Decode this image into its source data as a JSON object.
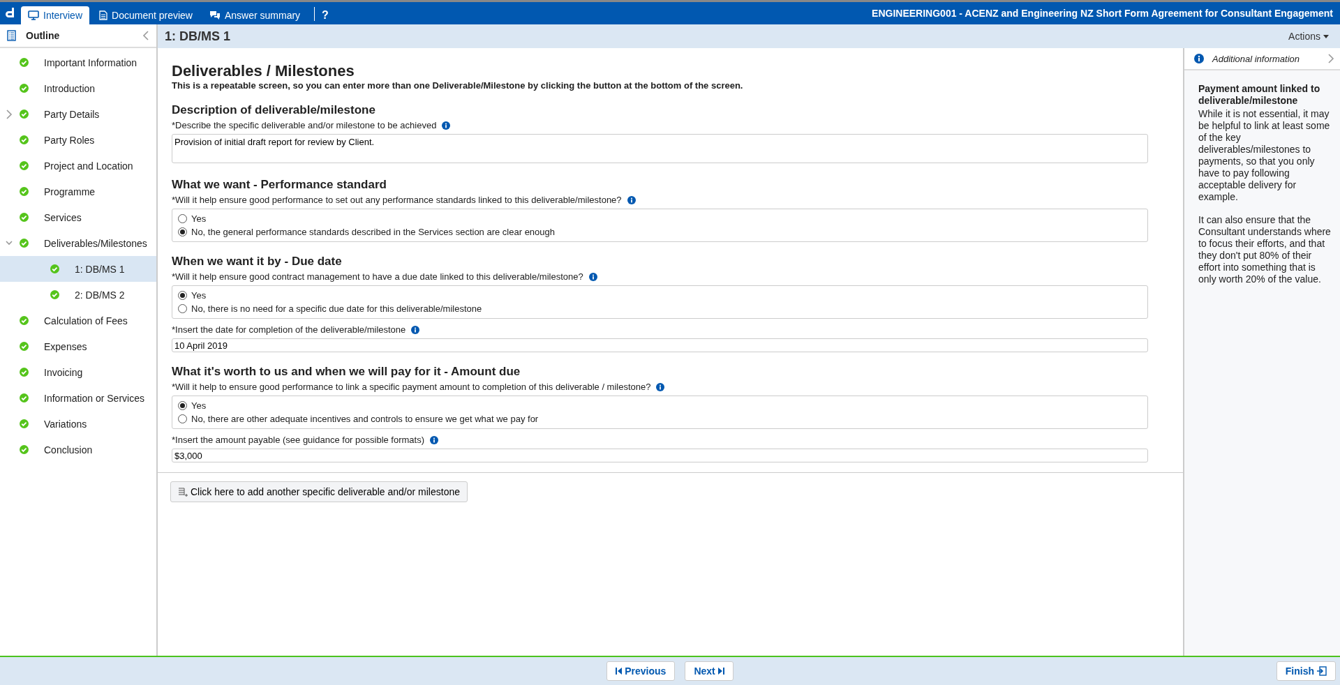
{
  "top_bar": {
    "tabs": [
      {
        "label": "Interview",
        "selected": true
      },
      {
        "label": "Document preview",
        "selected": false
      },
      {
        "label": "Answer summary",
        "selected": false
      }
    ],
    "help": "?",
    "title": "ENGINEERING001 - ACENZ and Engineering NZ Short Form Agreement for Consultant Engagement"
  },
  "sidebar": {
    "title": "Outline",
    "items": [
      {
        "label": "Important Information",
        "selected": false
      },
      {
        "label": "Introduction",
        "selected": false
      },
      {
        "label": "Party Details",
        "selected": false,
        "expanded": false
      },
      {
        "label": "Party Roles",
        "selected": false
      },
      {
        "label": "Project and Location",
        "selected": false
      },
      {
        "label": "Programme",
        "selected": false
      },
      {
        "label": "Services",
        "selected": false
      },
      {
        "label": "Deliverables/Milestones",
        "selected": false,
        "expanded": true,
        "children": [
          {
            "label": "1: DB/MS 1",
            "selected": true
          },
          {
            "label": "2: DB/MS 2",
            "selected": false
          }
        ]
      },
      {
        "label": "Calculation of Fees",
        "selected": false
      },
      {
        "label": "Expenses",
        "selected": false
      },
      {
        "label": "Invoicing",
        "selected": false
      },
      {
        "label": "Information or Services",
        "selected": false
      },
      {
        "label": "Variations",
        "selected": false
      },
      {
        "label": "Conclusion",
        "selected": false
      }
    ]
  },
  "page_header": {
    "title": "1: DB/MS 1",
    "actions": "Actions"
  },
  "form": {
    "title": "Deliverables / Milestones",
    "intro": "This is a repeatable screen, so you can enter more than one Deliverable/Milestone by clicking the button at the bottom of the screen.",
    "sections": [
      {
        "heading": "Description of deliverable/milestone",
        "questions": [
          {
            "kind": "textarea",
            "label": "*Describe the specific deliverable and/or milestone to be achieved",
            "value": "Provision of initial draft report for review by Client."
          }
        ]
      },
      {
        "heading": "What we want - Performance standard",
        "questions": [
          {
            "kind": "radio",
            "label": "*Will it help ensure good performance to set out any performance standards linked to this deliverable/milestone?",
            "options": [
              {
                "label": "Yes",
                "selected": false
              },
              {
                "label": "No, the general performance standards described in the Services section are clear enough",
                "selected": true
              }
            ]
          }
        ]
      },
      {
        "heading": "When we want it by - Due date",
        "questions": [
          {
            "kind": "radio",
            "label": "*Will it help ensure good contract management to have a due date linked to this deliverable/milestone?",
            "options": [
              {
                "label": "Yes",
                "selected": true
              },
              {
                "label": "No, there is no need for a specific due date for this deliverable/milestone",
                "selected": false
              }
            ]
          },
          {
            "kind": "text",
            "label": "*Insert the date for completion of the deliverable/milestone",
            "value": "10 April 2019"
          }
        ]
      },
      {
        "heading": "What it's worth to us and when we will pay for it - Amount due",
        "questions": [
          {
            "kind": "radio",
            "label": "*Will it help to ensure good performance to link a specific payment amount to completion of this deliverable / milestone?",
            "options": [
              {
                "label": "Yes",
                "selected": true
              },
              {
                "label": "No, there are other adequate incentives and controls to ensure we get what we pay for",
                "selected": false
              }
            ]
          },
          {
            "kind": "text",
            "label": "*Insert the amount payable (see guidance for possible formats)",
            "value": "$3,000"
          }
        ]
      }
    ],
    "add_button": "Click here to add another specific deliverable and/or milestone"
  },
  "info_panel": {
    "title": "Additional information",
    "heading": "Payment amount linked to deliverable/milestone",
    "paragraphs": [
      "While it is not essential, it may be helpful to link at least some of the key deliverables/milestones to payments, so that you only have to pay following acceptable delivery for example.",
      "It can also ensure that the Consultant understands where to focus their efforts, and that they don't put 80% of their effort into something that is only worth 20% of the value."
    ]
  },
  "footer": {
    "previous": "Previous",
    "next": "Next",
    "finish": "Finish"
  }
}
